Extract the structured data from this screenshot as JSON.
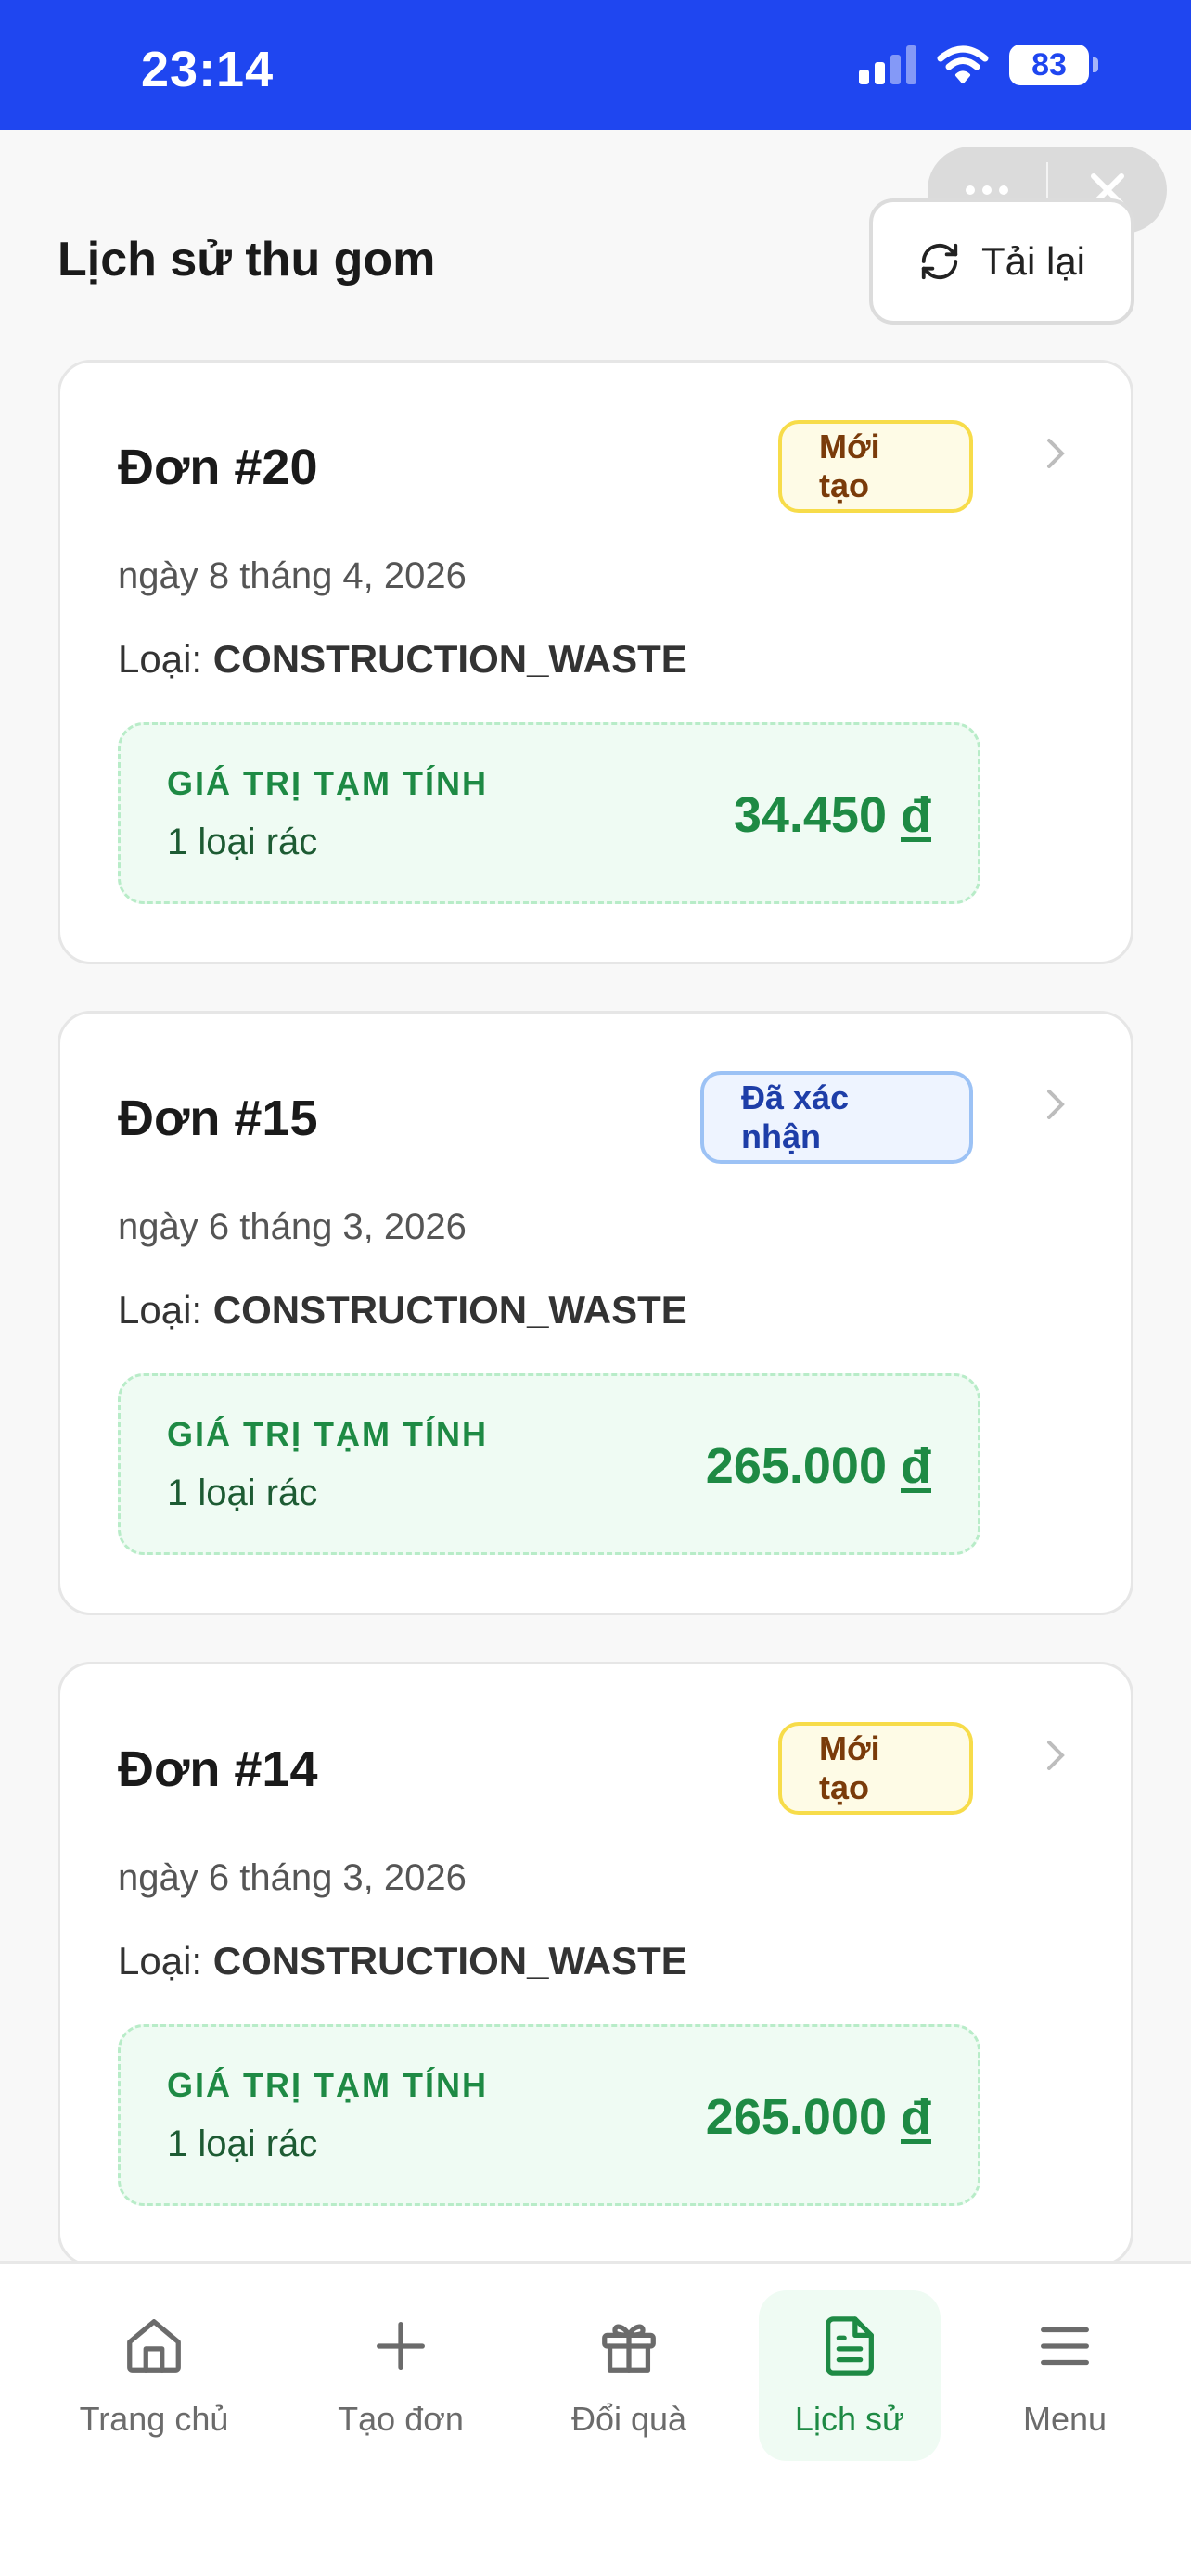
{
  "status_bar": {
    "time": "23:14",
    "battery": "83"
  },
  "header": {
    "title": "Lịch sử thu gom",
    "reload_label": "Tải lại"
  },
  "orders": [
    {
      "title": "Đơn #20",
      "status": "Mới tạo",
      "date": "ngày 8 tháng 4, 2026",
      "type_label": "Loại:",
      "type_value": "CONSTRUCTION_WASTE",
      "value_label": "GIÁ TRỊ TẠM TÍNH",
      "count": "1 loại rác",
      "amount": "34.450",
      "currency": "đ"
    },
    {
      "title": "Đơn #15",
      "status": "Đã xác nhận",
      "date": "ngày 6 tháng 3, 2026",
      "type_label": "Loại:",
      "type_value": "CONSTRUCTION_WASTE",
      "value_label": "GIÁ TRỊ TẠM TÍNH",
      "count": "1 loại rác",
      "amount": "265.000",
      "currency": "đ"
    },
    {
      "title": "Đơn #14",
      "status": "Mới tạo",
      "date": "ngày 6 tháng 3, 2026",
      "type_label": "Loại:",
      "type_value": "CONSTRUCTION_WASTE",
      "value_label": "GIÁ TRỊ TẠM TÍNH",
      "count": "1 loại rác",
      "amount": "265.000",
      "currency": "đ"
    }
  ],
  "nav": [
    {
      "label": "Trang chủ",
      "icon": "home-icon"
    },
    {
      "label": "Tạo đơn",
      "icon": "plus-icon"
    },
    {
      "label": "Đổi quà",
      "icon": "gift-icon"
    },
    {
      "label": "Lịch sử",
      "icon": "document-icon",
      "active": true
    },
    {
      "label": "Menu",
      "icon": "menu-icon"
    }
  ],
  "colors": {
    "status_bar": "#1f46f0",
    "accent_green": "#1e8a44",
    "badge_new_bg": "#fefbe6",
    "badge_new_border": "#f7dc4a",
    "badge_confirmed_bg": "#eef4ff",
    "badge_confirmed_border": "#9cc2f5"
  }
}
